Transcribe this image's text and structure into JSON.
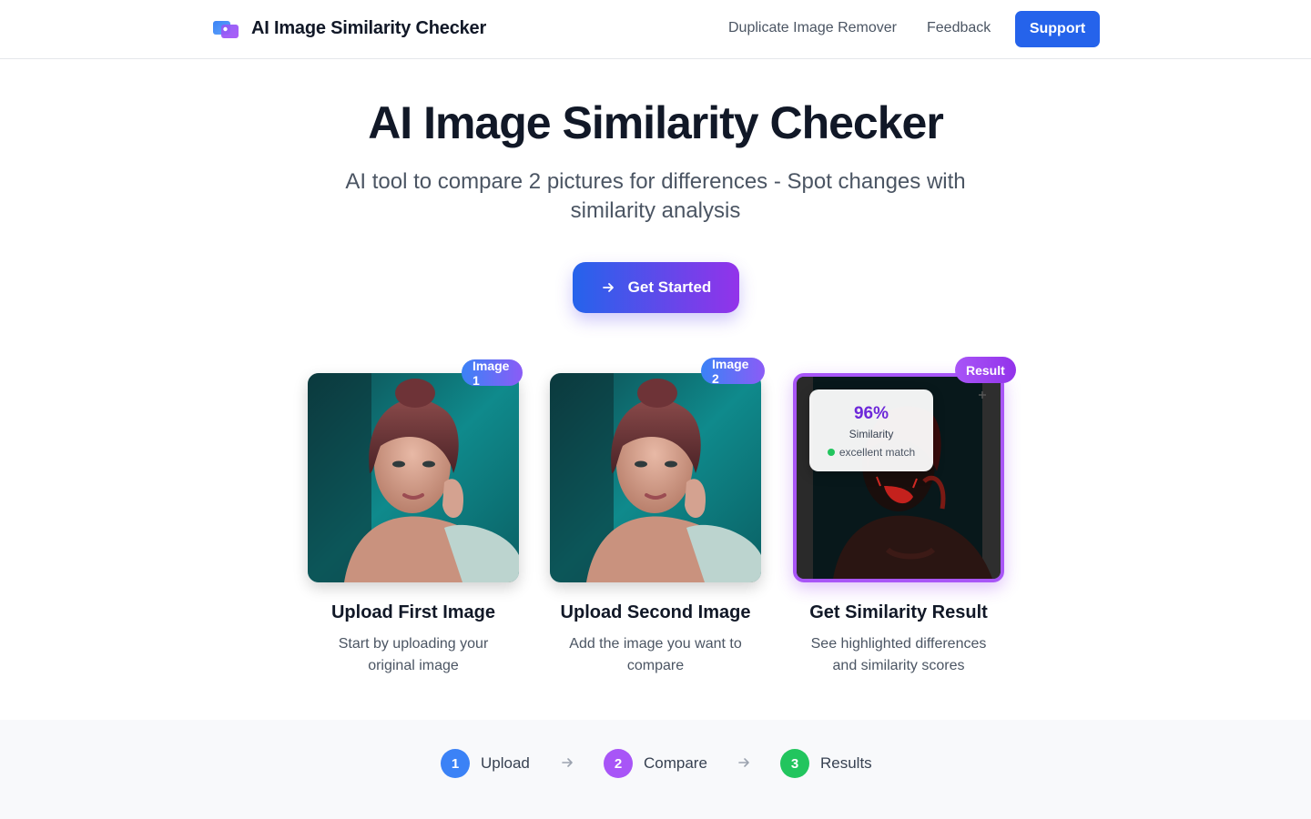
{
  "header": {
    "brand": "AI Image Similarity Checker",
    "nav": [
      "Duplicate Image Remover",
      "Feedback"
    ],
    "support_label": "Support"
  },
  "hero": {
    "title": "AI Image Similarity Checker",
    "subtitle": "AI tool to compare 2 pictures for differences - Spot changes with similarity analysis",
    "cta_label": "Get Started"
  },
  "cards": [
    {
      "badge": "Image 1",
      "title": "Upload First Image",
      "desc": "Start by uploading your original image"
    },
    {
      "badge": "Image 2",
      "title": "Upload Second Image",
      "desc": "Add the image you want to compare"
    },
    {
      "badge": "Result",
      "title": "Get Similarity Result",
      "desc": "See highlighted differences and similarity scores"
    }
  ],
  "result": {
    "percent": "96%",
    "label": "Similarity",
    "match": "excellent match"
  },
  "steps": [
    {
      "num": "1",
      "label": "Upload",
      "color": "#3b82f6"
    },
    {
      "num": "2",
      "label": "Compare",
      "color": "#a855f7"
    },
    {
      "num": "3",
      "label": "Results",
      "color": "#22c55e"
    }
  ],
  "colors": {
    "primary": "#2563eb",
    "accent_purple": "#9333ea",
    "match_green": "#22c55e"
  }
}
